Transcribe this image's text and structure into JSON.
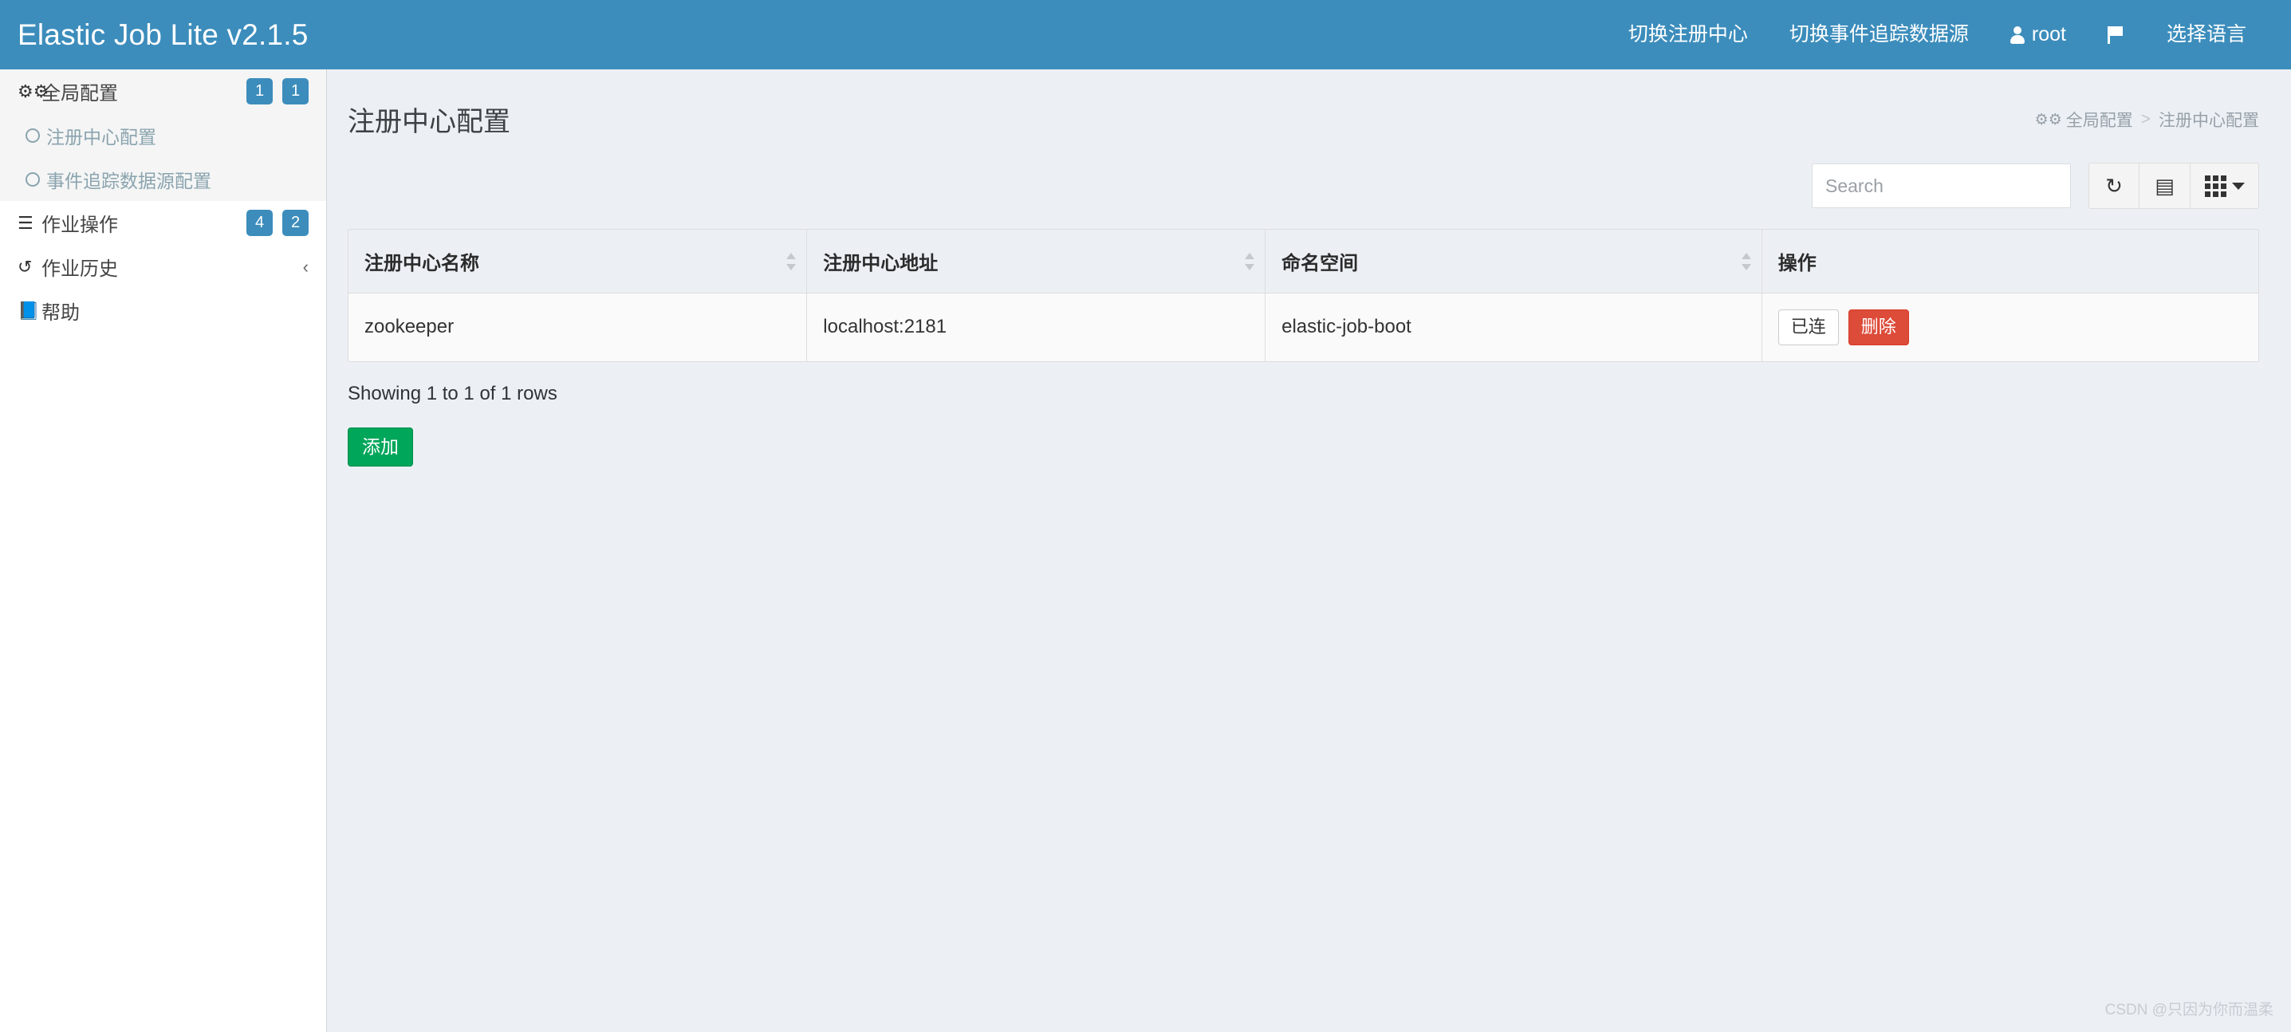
{
  "header": {
    "brand": "Elastic Job Lite v2.1.5",
    "accent_color": "#3c8dbc",
    "nav": [
      {
        "label": "切换注册中心",
        "icon": ""
      },
      {
        "label": "切换事件追踪数据源",
        "icon": ""
      },
      {
        "label": "root",
        "icon": "user-icon"
      },
      {
        "label": "",
        "icon": "flag-icon"
      },
      {
        "label": "选择语言",
        "icon": ""
      }
    ]
  },
  "sidebar": {
    "items": [
      {
        "label": "全局配置",
        "icon": "gears-icon",
        "badges": [
          "1",
          "1"
        ],
        "children": [
          {
            "label": "注册中心配置",
            "icon": "circle-icon"
          },
          {
            "label": "事件追踪数据源配置",
            "icon": "circle-icon"
          }
        ]
      },
      {
        "label": "作业操作",
        "icon": "list-icon",
        "badges": [
          "4",
          "2"
        ],
        "children": []
      },
      {
        "label": "作业历史",
        "icon": "history-icon",
        "chevron": "‹",
        "children": []
      },
      {
        "label": "帮助",
        "icon": "book-icon",
        "children": []
      }
    ]
  },
  "main": {
    "page_title": "注册中心配置",
    "breadcrumb": {
      "root_icon": "gears-icon",
      "root": "全局配置",
      "separator": ">",
      "current": "注册中心配置"
    },
    "toolbar": {
      "search_placeholder": "Search",
      "search_value": "",
      "refresh_icon": "refresh-icon",
      "toggle_icon": "list-view-icon",
      "columns_icon": "grid-columns-icon"
    },
    "table": {
      "columns": [
        "注册中心名称",
        "注册中心地址",
        "命名空间",
        "操作"
      ],
      "rows": [
        {
          "name": "zookeeper",
          "address": "localhost:2181",
          "namespace": "elastic-job-boot",
          "actions": [
            {
              "label": "已连",
              "style": "default"
            },
            {
              "label": "删除",
              "style": "danger"
            }
          ]
        }
      ]
    },
    "showing_text": "Showing 1 to 1 of 1 rows",
    "add_button": "添加"
  },
  "watermark": "CSDN @只因为你而温柔"
}
